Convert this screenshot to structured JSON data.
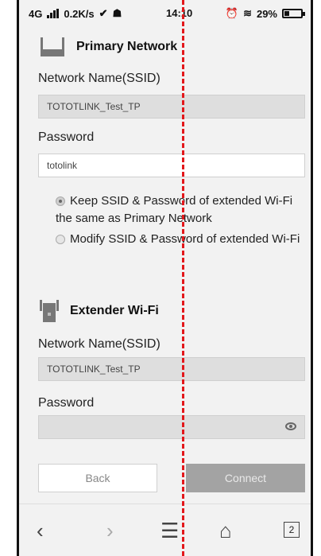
{
  "status": {
    "network": "4G",
    "speed": "0.2K/s",
    "time": "14:10",
    "battery": "29%"
  },
  "primary": {
    "title": "Primary Network",
    "ssid_label": "Network Name(SSID)",
    "ssid_value": "TOTOTLINK_Test_TP",
    "password_label": "Password",
    "password_value": "totolink"
  },
  "options": {
    "keep_text": "Keep SSID & Password of extended Wi-Fi the same as Primary Network",
    "modify_text": "Modify SSID & Password of extended Wi-Fi"
  },
  "extender": {
    "title": "Extender Wi-Fi",
    "ssid_label": "Network Name(SSID)",
    "ssid_value": "TOTOTLINK_Test_TP",
    "password_label": "Password",
    "password_value": ""
  },
  "buttons": {
    "back": "Back",
    "connect": "Connect"
  },
  "nav": {
    "tab_count": "2"
  }
}
